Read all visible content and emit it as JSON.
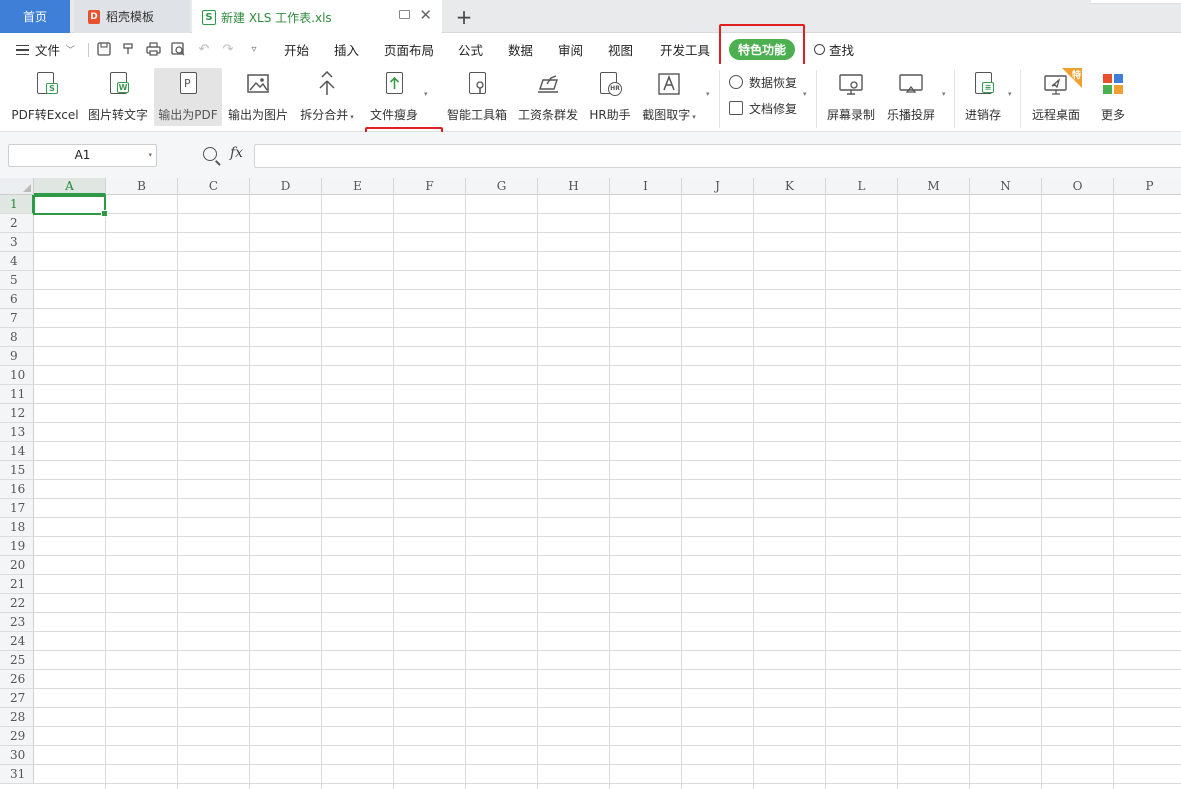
{
  "tabs": {
    "home": "首页",
    "doc": "稻壳模板",
    "doc_icon": "D",
    "file": "新建 XLS 工作表.xls",
    "file_icon": "S"
  },
  "menu": {
    "file": "文件",
    "items": [
      "开始",
      "插入",
      "页面布局",
      "公式",
      "数据",
      "审阅",
      "视图",
      "开发工具"
    ],
    "special": "特色功能",
    "search": "查找"
  },
  "ribbon": {
    "buttons": [
      "PDF转Excel",
      "图片转文字",
      "输出为PDF",
      "输出为图片",
      "拆分合并",
      "文件瘦身",
      "智能工具箱",
      "工资条群发",
      "HR助手",
      "截图取字"
    ],
    "recovery": [
      "数据恢复",
      "文档修复"
    ],
    "buttons2": [
      "屏幕录制",
      "乐播投屏",
      "进销存",
      "远程桌面",
      "更多"
    ],
    "remote_badge": "特"
  },
  "formula_bar": {
    "cell_ref": "A1",
    "fx": "fx",
    "content": ""
  },
  "sheet": {
    "columns": [
      "A",
      "B",
      "C",
      "D",
      "E",
      "F",
      "G",
      "H",
      "I",
      "J",
      "K",
      "L",
      "M",
      "N",
      "O",
      "P"
    ],
    "rows": [
      "1",
      "2",
      "3",
      "4",
      "5",
      "6",
      "7",
      "8",
      "9",
      "10",
      "11",
      "12",
      "13",
      "14",
      "15",
      "16",
      "17",
      "18",
      "19",
      "20",
      "21",
      "22",
      "23",
      "24",
      "25",
      "26",
      "27",
      "28",
      "29",
      "30",
      "31"
    ],
    "selected_cell": "A1"
  },
  "colors": {
    "accent_green": "#2f9a46",
    "special_pill": "#4caf50",
    "home_tab": "#3f7fd8",
    "highlight_red": "#e02020"
  }
}
